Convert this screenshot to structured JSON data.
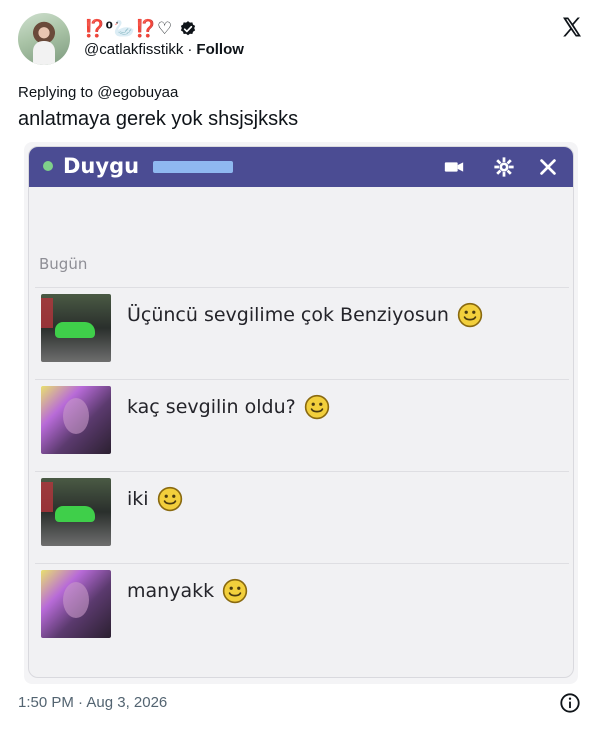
{
  "tweet": {
    "display_name": "⁉️⁰🦢⁉️♡",
    "handle": "@catlakfisstikk",
    "separator": "·",
    "follow_label": "Follow",
    "reply_to": "Replying to @egobuyaa",
    "text": "anlatmaya gerek yok shsjsjksks",
    "timestamp": "1:50 PM · Aug 3, 2026",
    "icons": {
      "verified": "verified-badge-icon",
      "x_logo": "x-logo-icon",
      "info": "info-icon"
    }
  },
  "chat": {
    "title": "Duygu",
    "date_label": "Bugün",
    "title_bar_color": "#4b4c93",
    "messages": [
      {
        "avatar": "car",
        "text": "Üçüncü sevgilime çok Benziyosun",
        "emoji": "smiley-icon"
      },
      {
        "avatar": "girl",
        "text": "kaç sevgilin oldu?",
        "emoji": "smiley-icon"
      },
      {
        "avatar": "car",
        "text": "iki",
        "emoji": "smiley-icon"
      },
      {
        "avatar": "girl",
        "text": "manyakk",
        "emoji": "smiley-icon"
      }
    ]
  }
}
